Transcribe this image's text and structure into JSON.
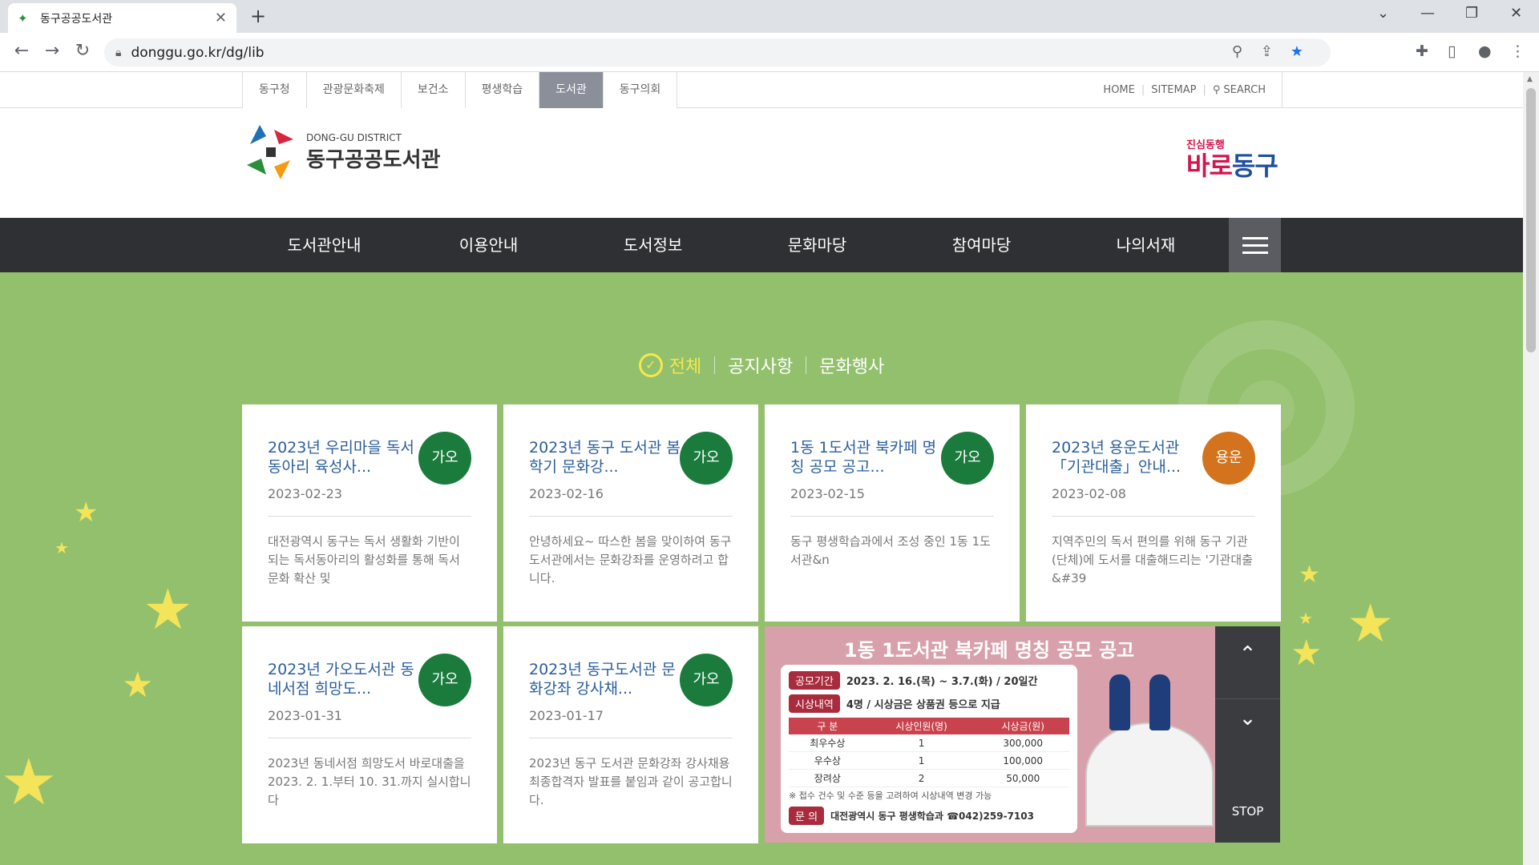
{
  "browser": {
    "tab_title": "동구공공도서관",
    "url": "donggu.go.kr/dg/lib",
    "back_icon": "←",
    "forward_icon": "→",
    "reload_icon": "↻"
  },
  "site_tabs": [
    {
      "label": "동구청"
    },
    {
      "label": "관광문화축제"
    },
    {
      "label": "보건소"
    },
    {
      "label": "평생학습"
    },
    {
      "label": "도서관"
    },
    {
      "label": "동구의회"
    }
  ],
  "util": {
    "home": "HOME",
    "sitemap": "SITEMAP",
    "search": "SEARCH"
  },
  "logo": {
    "sub": "DONG-GU DISTRICT",
    "main": "동구공공도서관"
  },
  "slogan": {
    "small": "진심동행",
    "big_a": "바로",
    "big_b": "동구"
  },
  "gnb": [
    {
      "label": "도서관안내"
    },
    {
      "label": "이용안내"
    },
    {
      "label": "도서정보"
    },
    {
      "label": "문화마당"
    },
    {
      "label": "참여마당"
    },
    {
      "label": "나의서재"
    }
  ],
  "filters": {
    "all": "전체",
    "notice": "공지사항",
    "events": "문화행사"
  },
  "cards": [
    {
      "title": "2023년 우리마을 독서동아리 육성사...",
      "date": "2023-02-23",
      "badge": "가오",
      "body": "대전광역시 동구는 독서 생활화 기반이 되는 독서동아리의 활성화를 통해 독서 문화 확산 및"
    },
    {
      "title": "2023년 동구 도서관 봄학기 문화강...",
      "date": "2023-02-16",
      "badge": "가오",
      "body": "안녕하세요~ 따스한 봄을 맞이하여 동구도서관에서는 문화강좌를 운영하려고 합니다."
    },
    {
      "title": "1동 1도서관 북카페 명칭 공모 공고...",
      "date": "2023-02-15",
      "badge": "가오",
      "body": "동구 평생학습과에서 조성 중인 1동 1도서관&n"
    },
    {
      "title": "2023년 용운도서관 「기관대출」안내...",
      "date": "2023-02-08",
      "badge": "용운",
      "body": "지역주민의 독서 편의를 위해 동구 기관(단체)에 도서를 대출해드리는 '기관대출&#39"
    },
    {
      "title": "2023년 가오도서관 동네서점 희망도...",
      "date": "2023-01-31",
      "badge": "가오",
      "body": "2023년 동네서점 희망도서 바로대출을 2023. 2. 1.부터 10. 31.까지 실시합니다"
    },
    {
      "title": "2023년 동구도서관 문화강좌 강사채...",
      "date": "2023-01-17",
      "badge": "가오",
      "body": "2023년 동구 도서관 문화강좌 강사채용 최종합격자 발표를 붙임과 같이 공고합니다."
    }
  ],
  "banner": {
    "title": "1동 1도서관 북카페 명칭 공모 공고",
    "period_label": "공모기간",
    "period": "2023. 2. 16.(목) ~ 3.7.(화) / 20일간",
    "award_label": "시상내역",
    "award": "4명 / 시상금은 상품권 등으로 지급",
    "table_head": [
      "구 분",
      "시상인원(명)",
      "시상금(원)"
    ],
    "table_rows": [
      [
        "최우수상",
        "1",
        "300,000"
      ],
      [
        "우수상",
        "1",
        "100,000"
      ],
      [
        "장려상",
        "2",
        "50,000"
      ]
    ],
    "note": "※ 접수 건수 및 수준 등을 고려하여 시상내역 변경 가능",
    "contact_label": "문 의",
    "contact": "대전광역시 동구 평생학습과 ☎042)259-7103",
    "up": "⌃",
    "down": "⌄",
    "stop": "STOP"
  },
  "colors": {
    "main_bg": "#93c06d",
    "gnb_bg": "#2f3033",
    "badge_green": "#1a7b3d",
    "badge_orange": "#d4731e",
    "title_blue": "#2a5e9c"
  }
}
